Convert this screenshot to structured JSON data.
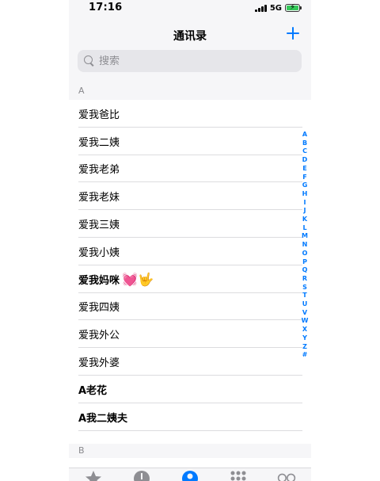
{
  "status": {
    "time": "17:16",
    "network": "5G"
  },
  "nav": {
    "title": "通讯录",
    "add_icon": "plus-icon"
  },
  "search": {
    "placeholder": "搜索",
    "value": ""
  },
  "sections": [
    {
      "letter": "A",
      "contacts": [
        {
          "name": "爱我爸比",
          "bold": false
        },
        {
          "name": "爱我二姨",
          "bold": false
        },
        {
          "name": "爱我老弟",
          "bold": false
        },
        {
          "name": "爱我老妹",
          "bold": false
        },
        {
          "name": "爱我三姨",
          "bold": false
        },
        {
          "name": "爱我小姨",
          "bold": false
        },
        {
          "name": "爱我妈咪",
          "bold": true,
          "emoji": "💓🤟"
        },
        {
          "name": "爱我四姨",
          "bold": false
        },
        {
          "name": "爱我外公",
          "bold": false
        },
        {
          "name": "爱我外婆",
          "bold": false
        },
        {
          "name": "A老花",
          "bold": true
        },
        {
          "name": "A我二姨夫",
          "bold": true
        }
      ]
    },
    {
      "letter": "B",
      "contacts": []
    }
  ],
  "index_letters": [
    "A",
    "B",
    "C",
    "D",
    "E",
    "F",
    "G",
    "H",
    "I",
    "J",
    "K",
    "L",
    "M",
    "N",
    "O",
    "P",
    "Q",
    "R",
    "S",
    "T",
    "U",
    "V",
    "W",
    "X",
    "Y",
    "Z",
    "#"
  ],
  "tabs": [
    {
      "name": "tab-favorites",
      "icon": "star-icon"
    },
    {
      "name": "tab-recents",
      "icon": "clock-icon"
    },
    {
      "name": "tab-contacts",
      "icon": "person-icon"
    },
    {
      "name": "tab-keypad",
      "icon": "keypad-icon"
    },
    {
      "name": "tab-voicemail",
      "icon": "voicemail-icon"
    }
  ],
  "colors": {
    "accent": "#007aff",
    "battery": "#34c759",
    "inactive_tab": "#8e8e93"
  }
}
